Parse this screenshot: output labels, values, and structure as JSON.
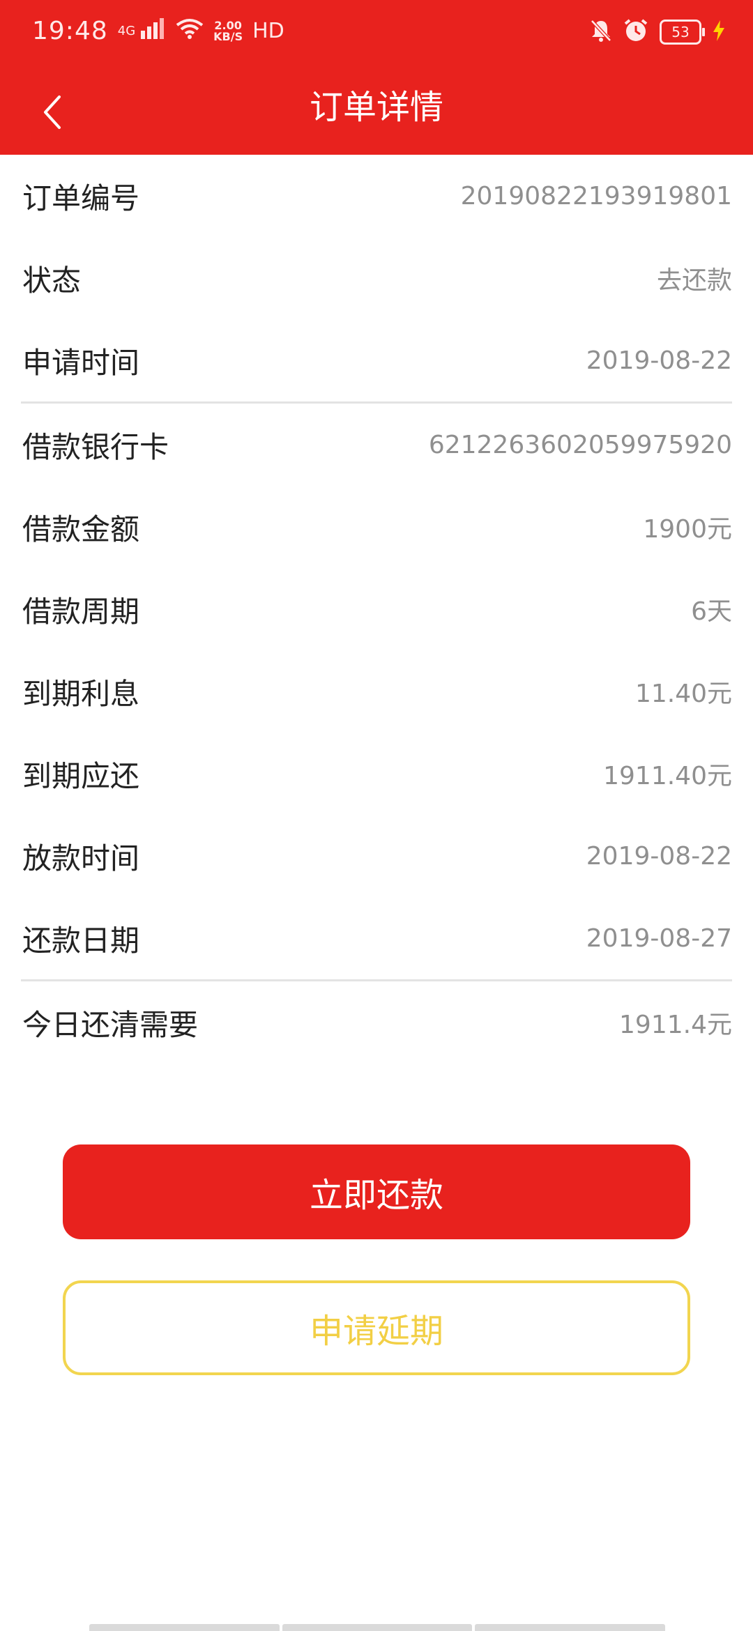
{
  "status_bar": {
    "time": "19:48",
    "network_type": "4G",
    "speed_value": "2.00",
    "speed_unit": "KB/S",
    "hd": "HD",
    "battery": "53",
    "icons": [
      "signal-icon",
      "wifi-icon",
      "mute-icon",
      "alarm-icon",
      "battery-icon",
      "charging-icon"
    ]
  },
  "header": {
    "title": "订单详情",
    "back_icon": "chevron-left-icon",
    "color": "#e8221e"
  },
  "details": {
    "order_no": {
      "label": "订单编号",
      "value": "20190822193919801"
    },
    "status": {
      "label": "状态",
      "value": "去还款"
    },
    "apply_time": {
      "label": "申请时间",
      "value": "2019-08-22"
    },
    "bank_card": {
      "label": "借款银行卡",
      "value": "6212263602059975920"
    },
    "amount": {
      "label": "借款金额",
      "value": "1900元"
    },
    "period": {
      "label": "借款周期",
      "value": "6天"
    },
    "interest": {
      "label": "到期利息",
      "value": "11.40元"
    },
    "due_total": {
      "label": "到期应还",
      "value": "1911.40元"
    },
    "loan_time": {
      "label": "放款时间",
      "value": "2019-08-22"
    },
    "repay_date": {
      "label": "还款日期",
      "value": "2019-08-27"
    },
    "today_payoff": {
      "label": "今日还清需要",
      "value": "1911.4元"
    }
  },
  "actions": {
    "repay_now": "立即还款",
    "apply_extension": "申请延期",
    "primary_color": "#e8221e",
    "secondary_color": "#f2cf45"
  }
}
